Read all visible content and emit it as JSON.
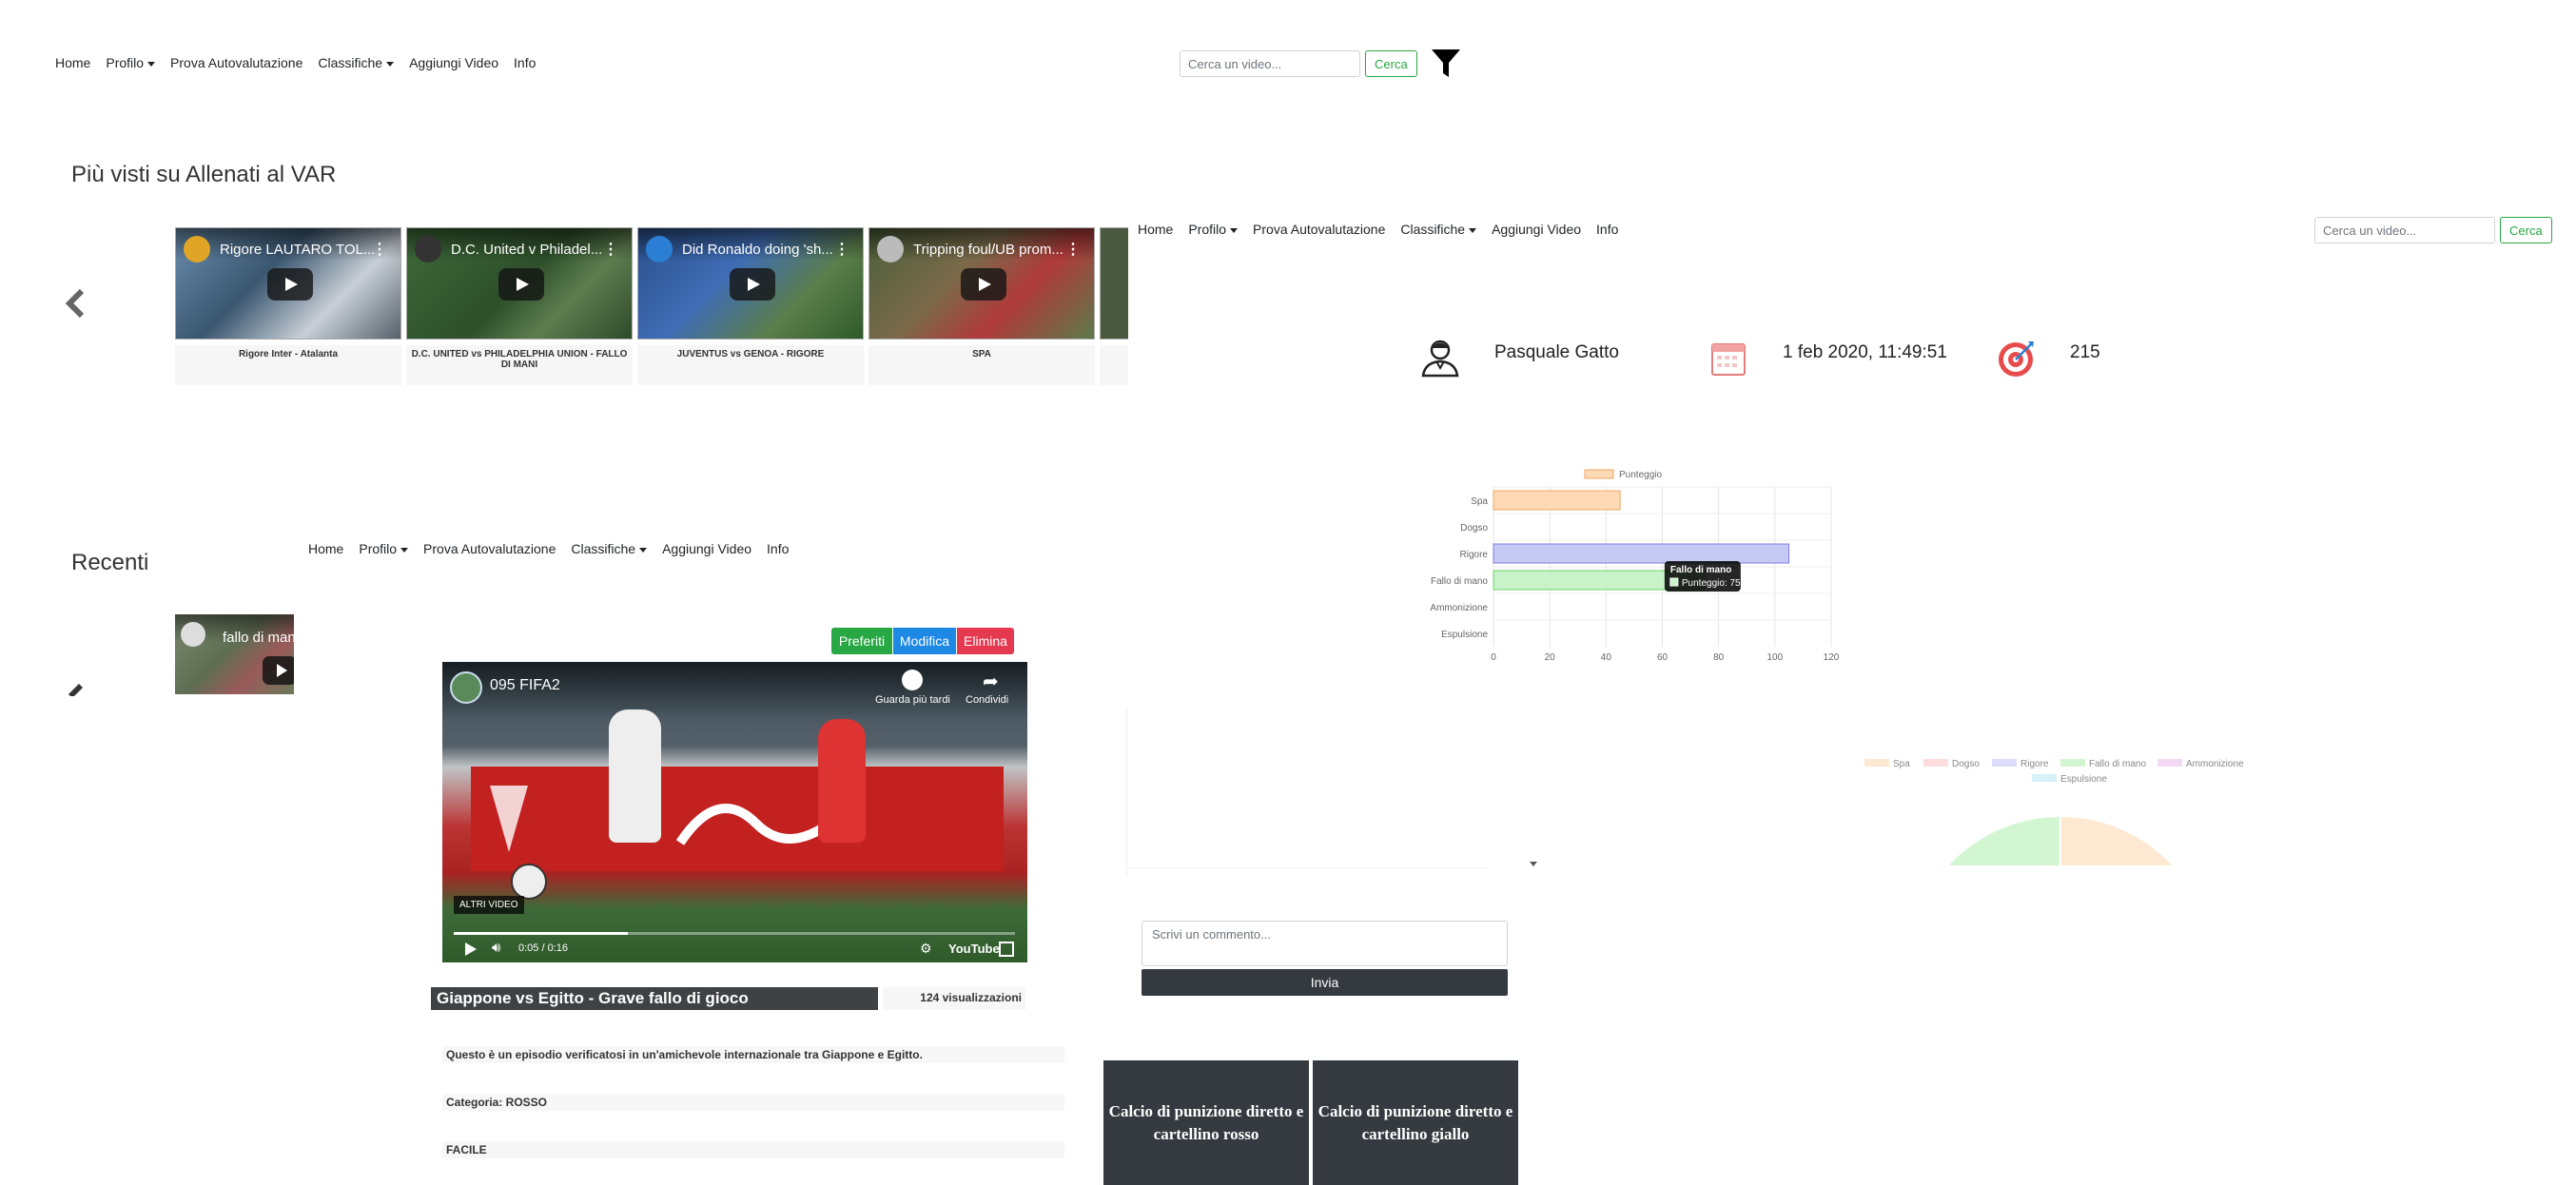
{
  "nav": {
    "home": "Home",
    "profilo": "Profilo",
    "prova": "Prova Autovalutazione",
    "classifiche": "Classifiche",
    "aggiungi": "Aggiungi Video",
    "info": "Info"
  },
  "search": {
    "placeholder": "Cerca un video...",
    "button": "Cerca"
  },
  "sections": {
    "most_viewed": "Più visti su Allenati al VAR",
    "recent": "Recenti"
  },
  "carousel": [
    {
      "title": "Rigore LAUTARO TOL...",
      "caption": "Rigore Inter - Atalanta",
      "avatar_color": "#e0a526"
    },
    {
      "title": "D.C. United v Philadel...",
      "caption": "D.C. UNITED vs PHILADELPHIA UNION - FALLO DI MANI",
      "avatar_color": "#333333"
    },
    {
      "title": "Did Ronaldo doing 'sh...",
      "caption": "JUVENTUS vs GENOA - RIGORE",
      "avatar_color": "#2a7fd4"
    },
    {
      "title": "Tripping foul/UB prom...",
      "caption": "SPA",
      "avatar_color": "#bbbbbb"
    }
  ],
  "recent_item": {
    "title": "fallo di man"
  },
  "profile": {
    "name": "Pasquale Gatto",
    "date": "1 feb 2020, 11:49:51",
    "score": "215"
  },
  "video": {
    "channel": "095 FIFA2",
    "watch_later": "Guarda più tardi",
    "share": "Condividi",
    "more_videos": "ALTRI VIDEO",
    "time": "0:05 / 0:16",
    "youtube": "YouTube",
    "title": "Giappone vs Egitto - Grave fallo di gioco",
    "views": "124 visualizzazioni",
    "description": "Questo è un episodio verificatosi in un'amichevole internazionale tra Giappone e Egitto.",
    "category": "Categoria: ROSSO",
    "difficulty": "FACILE"
  },
  "actions": {
    "preferiti": "Preferiti",
    "modifica": "Modifica",
    "elimina": "Elimina"
  },
  "comment": {
    "placeholder": "Scrivi un commento...",
    "submit": "Invia"
  },
  "answers": [
    "Calcio di punizione diretto e cartellino rosso",
    "Calcio di punizione diretto e cartellino giallo"
  ],
  "chart_data": [
    {
      "type": "bar",
      "orientation": "horizontal",
      "categories": [
        "Spa",
        "Dogso",
        "Rigore",
        "Fallo di mano",
        "Ammonizione",
        "Espulsione"
      ],
      "series": [
        {
          "name": "Punteggio",
          "values": [
            45,
            0,
            105,
            75,
            0,
            0
          ]
        }
      ],
      "xlim": [
        0,
        120
      ],
      "xticks": [
        0,
        20,
        40,
        60,
        80,
        100,
        120
      ],
      "legend": "top",
      "colors": [
        "#fdd9b5",
        "#ffffff",
        "#c7c9f5",
        "#c8f2c8",
        "#ffffff",
        "#ffffff"
      ],
      "borders": [
        "#f0a860",
        "#ffffff",
        "#7a7fe0",
        "#6cd26c",
        "#ffffff",
        "#ffffff"
      ],
      "tooltip": {
        "title": "Fallo di mano",
        "label": "Punteggio: 75"
      }
    },
    {
      "type": "pie",
      "legend": [
        "Spa",
        "Dogso",
        "Rigore",
        "Fallo di mano",
        "Ammonizione",
        "Espulsione"
      ],
      "colors": [
        "#fde8d2",
        "#fcdcdc",
        "#dcdcfc",
        "#d2f5d2",
        "#f3d9f3",
        "#d6f1f7"
      ]
    }
  ]
}
